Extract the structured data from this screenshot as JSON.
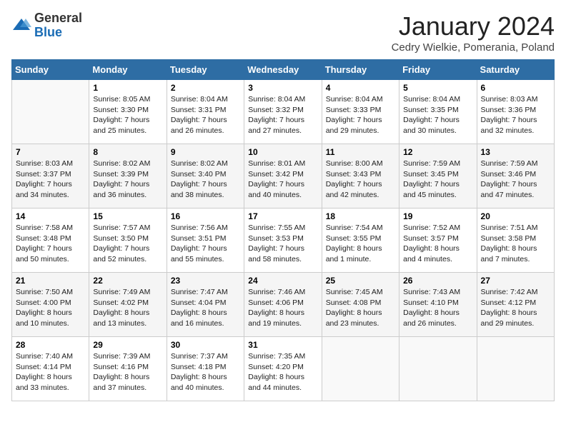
{
  "header": {
    "logo_general": "General",
    "logo_blue": "Blue",
    "month_title": "January 2024",
    "subtitle": "Cedry Wielkie, Pomerania, Poland"
  },
  "days_of_week": [
    "Sunday",
    "Monday",
    "Tuesday",
    "Wednesday",
    "Thursday",
    "Friday",
    "Saturday"
  ],
  "weeks": [
    [
      {
        "day": "",
        "info": ""
      },
      {
        "day": "1",
        "info": "Sunrise: 8:05 AM\nSunset: 3:30 PM\nDaylight: 7 hours\nand 25 minutes."
      },
      {
        "day": "2",
        "info": "Sunrise: 8:04 AM\nSunset: 3:31 PM\nDaylight: 7 hours\nand 26 minutes."
      },
      {
        "day": "3",
        "info": "Sunrise: 8:04 AM\nSunset: 3:32 PM\nDaylight: 7 hours\nand 27 minutes."
      },
      {
        "day": "4",
        "info": "Sunrise: 8:04 AM\nSunset: 3:33 PM\nDaylight: 7 hours\nand 29 minutes."
      },
      {
        "day": "5",
        "info": "Sunrise: 8:04 AM\nSunset: 3:35 PM\nDaylight: 7 hours\nand 30 minutes."
      },
      {
        "day": "6",
        "info": "Sunrise: 8:03 AM\nSunset: 3:36 PM\nDaylight: 7 hours\nand 32 minutes."
      }
    ],
    [
      {
        "day": "7",
        "info": "Sunrise: 8:03 AM\nSunset: 3:37 PM\nDaylight: 7 hours\nand 34 minutes."
      },
      {
        "day": "8",
        "info": "Sunrise: 8:02 AM\nSunset: 3:39 PM\nDaylight: 7 hours\nand 36 minutes."
      },
      {
        "day": "9",
        "info": "Sunrise: 8:02 AM\nSunset: 3:40 PM\nDaylight: 7 hours\nand 38 minutes."
      },
      {
        "day": "10",
        "info": "Sunrise: 8:01 AM\nSunset: 3:42 PM\nDaylight: 7 hours\nand 40 minutes."
      },
      {
        "day": "11",
        "info": "Sunrise: 8:00 AM\nSunset: 3:43 PM\nDaylight: 7 hours\nand 42 minutes."
      },
      {
        "day": "12",
        "info": "Sunrise: 7:59 AM\nSunset: 3:45 PM\nDaylight: 7 hours\nand 45 minutes."
      },
      {
        "day": "13",
        "info": "Sunrise: 7:59 AM\nSunset: 3:46 PM\nDaylight: 7 hours\nand 47 minutes."
      }
    ],
    [
      {
        "day": "14",
        "info": "Sunrise: 7:58 AM\nSunset: 3:48 PM\nDaylight: 7 hours\nand 50 minutes."
      },
      {
        "day": "15",
        "info": "Sunrise: 7:57 AM\nSunset: 3:50 PM\nDaylight: 7 hours\nand 52 minutes."
      },
      {
        "day": "16",
        "info": "Sunrise: 7:56 AM\nSunset: 3:51 PM\nDaylight: 7 hours\nand 55 minutes."
      },
      {
        "day": "17",
        "info": "Sunrise: 7:55 AM\nSunset: 3:53 PM\nDaylight: 7 hours\nand 58 minutes."
      },
      {
        "day": "18",
        "info": "Sunrise: 7:54 AM\nSunset: 3:55 PM\nDaylight: 8 hours\nand 1 minute."
      },
      {
        "day": "19",
        "info": "Sunrise: 7:52 AM\nSunset: 3:57 PM\nDaylight: 8 hours\nand 4 minutes."
      },
      {
        "day": "20",
        "info": "Sunrise: 7:51 AM\nSunset: 3:58 PM\nDaylight: 8 hours\nand 7 minutes."
      }
    ],
    [
      {
        "day": "21",
        "info": "Sunrise: 7:50 AM\nSunset: 4:00 PM\nDaylight: 8 hours\nand 10 minutes."
      },
      {
        "day": "22",
        "info": "Sunrise: 7:49 AM\nSunset: 4:02 PM\nDaylight: 8 hours\nand 13 minutes."
      },
      {
        "day": "23",
        "info": "Sunrise: 7:47 AM\nSunset: 4:04 PM\nDaylight: 8 hours\nand 16 minutes."
      },
      {
        "day": "24",
        "info": "Sunrise: 7:46 AM\nSunset: 4:06 PM\nDaylight: 8 hours\nand 19 minutes."
      },
      {
        "day": "25",
        "info": "Sunrise: 7:45 AM\nSunset: 4:08 PM\nDaylight: 8 hours\nand 23 minutes."
      },
      {
        "day": "26",
        "info": "Sunrise: 7:43 AM\nSunset: 4:10 PM\nDaylight: 8 hours\nand 26 minutes."
      },
      {
        "day": "27",
        "info": "Sunrise: 7:42 AM\nSunset: 4:12 PM\nDaylight: 8 hours\nand 29 minutes."
      }
    ],
    [
      {
        "day": "28",
        "info": "Sunrise: 7:40 AM\nSunset: 4:14 PM\nDaylight: 8 hours\nand 33 minutes."
      },
      {
        "day": "29",
        "info": "Sunrise: 7:39 AM\nSunset: 4:16 PM\nDaylight: 8 hours\nand 37 minutes."
      },
      {
        "day": "30",
        "info": "Sunrise: 7:37 AM\nSunset: 4:18 PM\nDaylight: 8 hours\nand 40 minutes."
      },
      {
        "day": "31",
        "info": "Sunrise: 7:35 AM\nSunset: 4:20 PM\nDaylight: 8 hours\nand 44 minutes."
      },
      {
        "day": "",
        "info": ""
      },
      {
        "day": "",
        "info": ""
      },
      {
        "day": "",
        "info": ""
      }
    ]
  ]
}
